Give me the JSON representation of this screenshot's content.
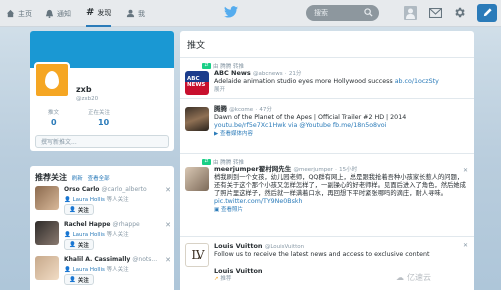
{
  "topbar": {
    "nav": [
      {
        "label": "主页",
        "icon": "home-icon"
      },
      {
        "label": "通知",
        "icon": "bell-icon"
      },
      {
        "label": "发现",
        "icon": "hashtag-icon"
      },
      {
        "label": "我",
        "icon": "user-icon"
      }
    ],
    "search_placeholder": "搜索",
    "icons": [
      "twitter-bird-icon",
      "envelope-icon",
      "gear-icon",
      "compose-icon"
    ],
    "accent": "#2b7bb9"
  },
  "profile": {
    "name": "zxb",
    "handle": "@zxb20",
    "stats": [
      {
        "label": "推文",
        "value": "0"
      },
      {
        "label": "正在关注",
        "value": "10"
      }
    ],
    "compose_placeholder": "撰写新推文..."
  },
  "who_to_follow": {
    "title": "推荐关注",
    "refresh": "刷新",
    "view_all": "查看全部",
    "follow_label": "关注",
    "users": [
      {
        "name": "Orso Carlo",
        "handle": "@carlo_alberto",
        "via_prefix": "",
        "via": "Laura Hollis",
        "via_suffix": "等人关注"
      },
      {
        "name": "Rachel Happe",
        "handle": "@rhappe",
        "via_prefix": "",
        "via": "Laura Hollis",
        "via_suffix": "等人关注"
      },
      {
        "name": "Khalil A. Cassimally",
        "handle": "@nots...",
        "via_prefix": "",
        "via": "Laura Hollis",
        "via_suffix": "等人关注"
      }
    ]
  },
  "timeline": {
    "title": "推文",
    "tweets": [
      {
        "retweet": "由 腾腾 转推",
        "name": "ABC News",
        "handle": "@abcnews",
        "time": "21分",
        "text": "Adelaide animation studio eyes more Hollywood success",
        "link": "ab.co/1oczSty",
        "action": "展开"
      },
      {
        "retweet": "",
        "name": "腾腾",
        "handle": "@kcome",
        "time": "47分",
        "text": "Dawn of the Planet of the Apes | Official Trailer #2 HD | 2014",
        "link": "youtu.be/rf5e7Xc1Hwk via @Youtube fb.me/18n5o8voi",
        "action": "查看媒体内容"
      },
      {
        "retweet": "由 腾腾 转推",
        "name": "meerjumper翟村网先生",
        "handle": "@meerjumper",
        "time": "15小时",
        "text": "梢我刷到一个女孩，幼儿园老师，QQ群有网上，总是跟我抢着吾种小孩家长惹人的问题，还有关于这个那个小孩又怎样怎样了，一副操心的好老师样。见面后进入了角色，然后她成了照片里这样子，然后就一样满着口水，再回想下平时紧张哪吗的滴庄，耐人寻味。",
        "link": "pic.twitter.com/TY9Ne0Bskh",
        "action": "查看照片"
      },
      {
        "retweet": "",
        "name": "Louis Vuitton",
        "handle": "@LouisVuitton",
        "time": "",
        "text": "Follow us to receive the latest news and access to exclusive content",
        "link": "",
        "action": ""
      },
      {
        "retweet": "",
        "name": "Louis Vuitton",
        "handle": "",
        "time": "",
        "text": "",
        "link": "",
        "action": "推荐"
      }
    ]
  },
  "watermark": "亿速云"
}
